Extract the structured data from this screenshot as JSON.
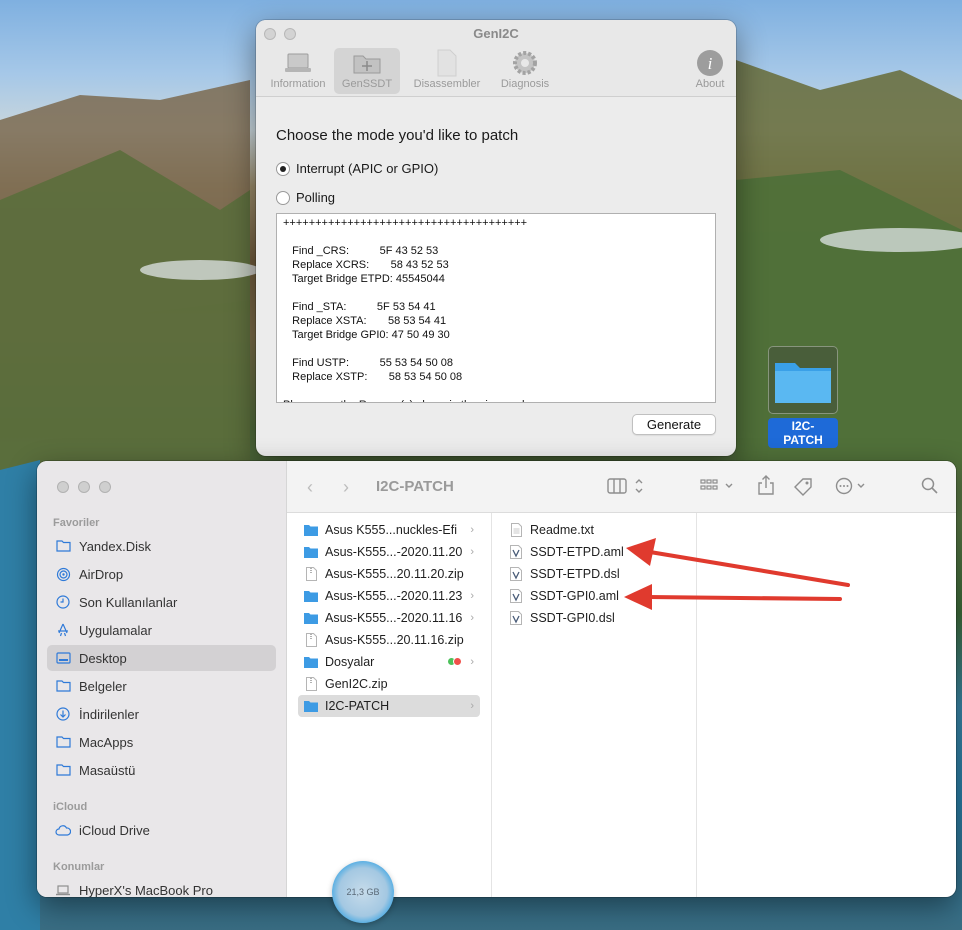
{
  "geni2c": {
    "title": "GenI2C",
    "toolbar": [
      {
        "label": "Information",
        "icon": "laptop-icon"
      },
      {
        "label": "GenSSDT",
        "icon": "folder-plus-icon",
        "selected": true
      },
      {
        "label": "Disassembler",
        "icon": "document-icon"
      },
      {
        "label": "Diagnosis",
        "icon": "gear-icon"
      },
      {
        "label": "About",
        "icon": "info-icon"
      }
    ],
    "prompt": "Choose the mode you'd like to patch",
    "modes": [
      {
        "label": "Interrupt (APIC or GPIO)",
        "checked": true
      },
      {
        "label": "Polling",
        "checked": false
      }
    ],
    "patch_text": "++++++++++++++++++++++++++++++++++++++\n\n   Find _CRS:          5F 43 52 53\n   Replace XCRS:       58 43 52 53\n   Target Bridge ETPD: 45545044\n\n   Find _STA:          5F 53 54 41\n   Replace XSTA:       58 53 54 41\n   Target Bridge GPI0: 47 50 49 30\n\n   Find USTP:          55 53 54 50 08\n   Replace XSTP:       58 53 54 50 08\n\nPlease use the Rename(s) above in the given order",
    "generate_label": "Generate"
  },
  "desktop_folder": {
    "label": "I2C-PATCH",
    "color": "#1e6ad8"
  },
  "finder": {
    "title": "I2C-PATCH",
    "sidebar": {
      "favorites_header": "Favoriler",
      "favorites": [
        {
          "label": "Yandex.Disk",
          "icon": "folder-icon"
        },
        {
          "label": "AirDrop",
          "icon": "airdrop-icon"
        },
        {
          "label": "Son Kullanılanlar",
          "icon": "clock-icon"
        },
        {
          "label": "Uygulamalar",
          "icon": "applications-icon"
        },
        {
          "label": "Desktop",
          "icon": "desktop-icon",
          "active": true
        },
        {
          "label": "Belgeler",
          "icon": "document-icon"
        },
        {
          "label": "İndirilenler",
          "icon": "download-icon"
        },
        {
          "label": "MacApps",
          "icon": "folder-icon"
        },
        {
          "label": "Masaüstü",
          "icon": "folder-icon"
        }
      ],
      "icloud_header": "iCloud",
      "icloud": [
        {
          "label": "iCloud Drive",
          "icon": "cloud-icon"
        }
      ],
      "locations_header": "Konumlar",
      "locations": [
        {
          "label": "HyperX's MacBook Pro",
          "icon": "laptop-icon"
        }
      ]
    },
    "column1": [
      {
        "name": "Asus K555...nuckles-Efi",
        "type": "folder",
        "chevron": true
      },
      {
        "name": "Asus-K555...-2020.11.20",
        "type": "folder",
        "chevron": true
      },
      {
        "name": "Asus-K555...20.11.20.zip",
        "type": "zip",
        "chevron": false
      },
      {
        "name": "Asus-K555...-2020.11.23",
        "type": "folder",
        "chevron": true
      },
      {
        "name": "Asus-K555...-2020.11.16",
        "type": "folder",
        "chevron": true
      },
      {
        "name": "Asus-K555...20.11.16.zip",
        "type": "zip",
        "chevron": false
      },
      {
        "name": "Dosyalar",
        "type": "folder",
        "chevron": true,
        "tags": [
          "#4cc15a",
          "#f0504a"
        ]
      },
      {
        "name": "GenI2C.zip",
        "type": "zip",
        "chevron": false
      },
      {
        "name": "I2C-PATCH",
        "type": "folder",
        "chevron": true,
        "selected": true
      }
    ],
    "column2": [
      {
        "name": "Readme.txt",
        "type": "text"
      },
      {
        "name": "SSDT-ETPD.aml",
        "type": "aml"
      },
      {
        "name": "SSDT-ETPD.dsl",
        "type": "aml"
      },
      {
        "name": "SSDT-GPI0.aml",
        "type": "aml"
      },
      {
        "name": "SSDT-GPI0.dsl",
        "type": "aml"
      }
    ]
  },
  "storage_badge": "21,3 GB",
  "annotation_color": "#e03a2e"
}
